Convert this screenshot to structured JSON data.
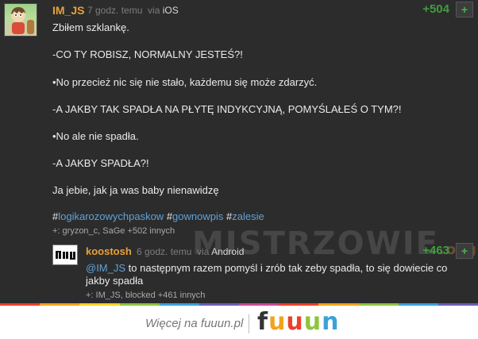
{
  "post": {
    "author": "IM_JS",
    "time": "7 godz. temu",
    "via": "via",
    "platform": "iOS",
    "votes": "+504",
    "plus": "+",
    "lines": [
      "Zbiłem szklankę.",
      "-CO TY ROBISZ, NORMALNY JESTEŚ?!",
      "•No przecież nic się nie stało, każdemu się może zdarzyć.",
      "-A JAKBY TAK SPADŁA NA PŁYTĘ INDYKCYJNĄ, POMYŚLAŁEŚ O TYM?!",
      "•No ale nie spadła.",
      "-A JAKBY SPADŁA?!",
      "Ja jebie, jak ja was baby nienawidzę"
    ],
    "hash": "#",
    "tags": [
      "logikarozowychpaskow",
      "gownowpis",
      "zalesie"
    ],
    "voters": "+: gryzon_c, SaGe +502 innych"
  },
  "reply": {
    "author": "koostosh",
    "time": "6 godz. temu",
    "via": "via",
    "platform": "Android",
    "votes": "+463",
    "plus": "+",
    "mention": "@IM_JS",
    "line1": " to następnym razem pomyśl i zrób tak zeby spadła, to się dowiecie co",
    "line2": "jakby spadła",
    "voters": "+: IM_JS, blocked +461 innych"
  },
  "watermark": {
    "text": "MISTRZOWIE",
    "tld": ".org"
  },
  "footer": {
    "link": "Więcej na fuuun.pl",
    "logo_letters": [
      "f",
      "u",
      "u",
      "u",
      "n"
    ],
    "logo_colors": [
      "#333333",
      "#f2a31b",
      "#e8412c",
      "#8fc43f",
      "#3aa2d8"
    ]
  },
  "rainbow_colors": [
    "#e8412c",
    "#f2a31b",
    "#f7d322",
    "#8fc43f",
    "#3aa2d8",
    "#6a5fb5",
    "#c94a9b",
    "#e8412c",
    "#f2a31b",
    "#8fc43f",
    "#3aa2d8",
    "#6a5fb5"
  ],
  "colors": {
    "author": "#e8a13a",
    "votes": "#3f9d3f",
    "tag": "#5fa2d8",
    "background": "#2c2c2c"
  }
}
